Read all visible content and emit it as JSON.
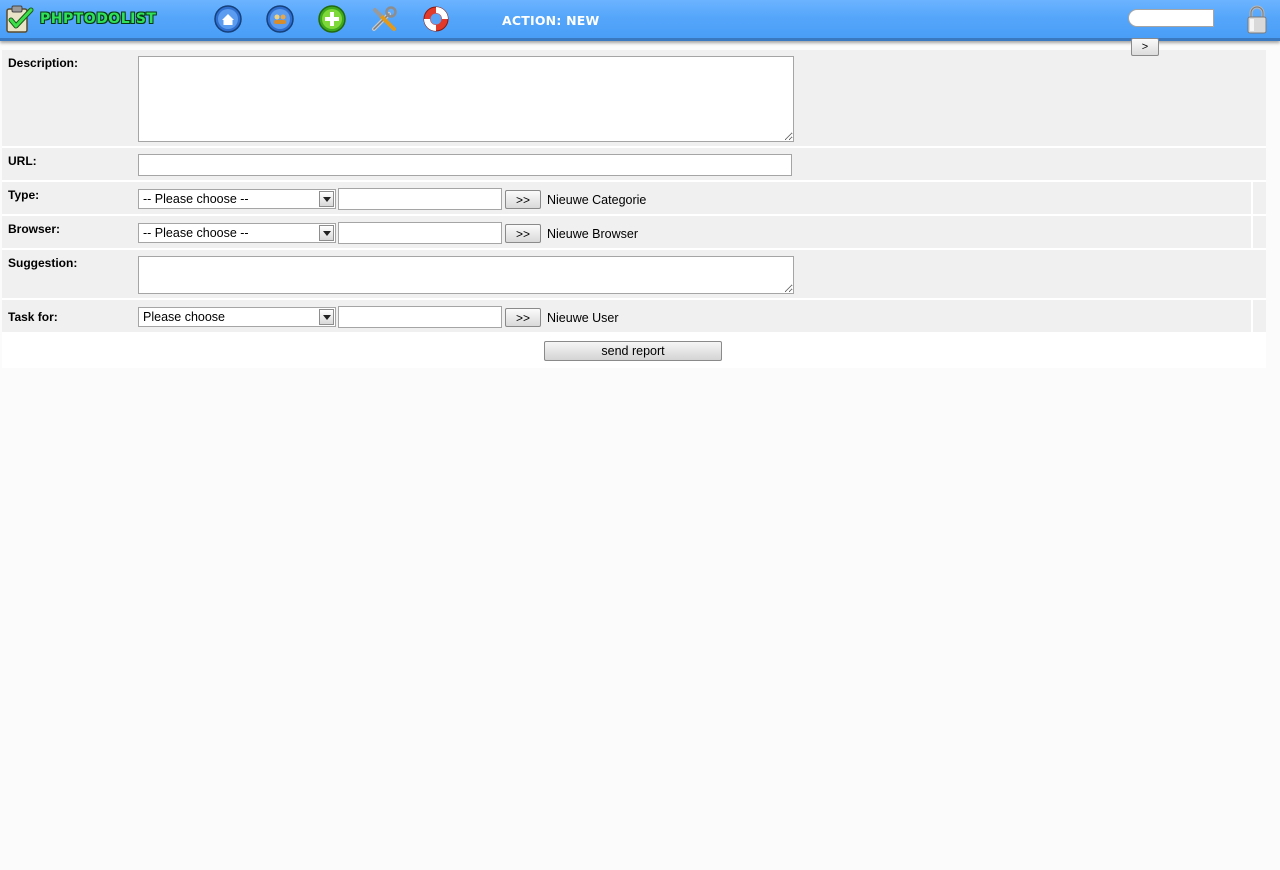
{
  "header": {
    "logo_text": "PHPTODOLIST",
    "action_label": "ACTION: NEW",
    "nav_icons": [
      "home-icon",
      "users-icon",
      "add-icon",
      "tools-icon",
      "help-icon"
    ],
    "search_placeholder": "",
    "search_button_label": ">"
  },
  "colors": {
    "header_blue": "#55a6fb",
    "header_border": "#3a78c0",
    "logo_green": "#2ee05a",
    "row_background": "#f0f0f0"
  },
  "form": {
    "description": {
      "label": "Description:",
      "value": ""
    },
    "url": {
      "label": "URL:",
      "value": ""
    },
    "type": {
      "label": "Type:",
      "selected": "-- Please choose --",
      "new_value": "",
      "add_button": ">>",
      "new_label": "Nieuwe Categorie"
    },
    "browser": {
      "label": "Browser:",
      "selected": "-- Please choose --",
      "new_value": "",
      "add_button": ">>",
      "new_label": "Nieuwe Browser"
    },
    "suggestion": {
      "label": "Suggestion:",
      "value": ""
    },
    "task_for": {
      "label": "Task for:",
      "selected": "Please choose",
      "new_value": "",
      "add_button": ">>",
      "new_label": "Nieuwe User"
    },
    "submit_label": "send report"
  }
}
